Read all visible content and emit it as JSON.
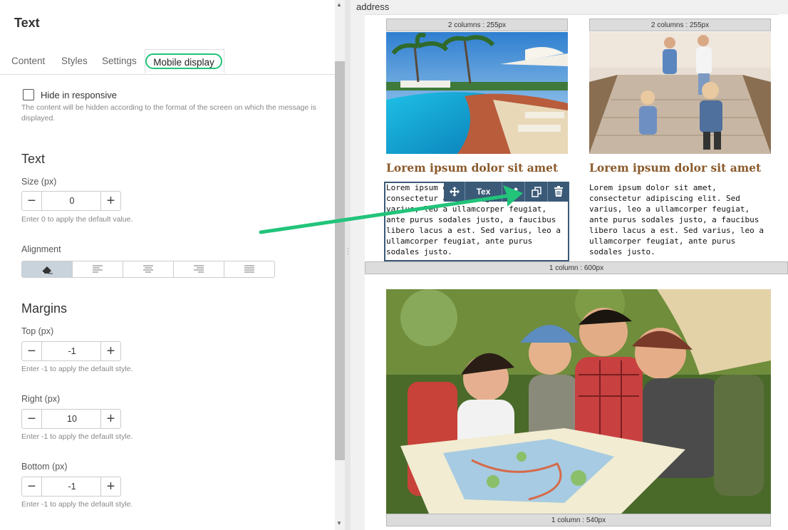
{
  "panel": {
    "title": "Text",
    "tabs": [
      {
        "label": "Content"
      },
      {
        "label": "Styles"
      },
      {
        "label": "Settings"
      },
      {
        "label": "Mobile display",
        "active": true
      }
    ],
    "hide_responsive": {
      "label": "Hide in responsive",
      "checked": false,
      "hint": "The content will be hidden according to the format of the screen on which the message is displayed."
    },
    "text_section": {
      "heading": "Text",
      "size_label": "Size (px)",
      "size_value": "0",
      "size_hint": "Enter 0 to apply the default value.",
      "alignment_label": "Alignment",
      "alignment_options": [
        "eraser-icon",
        "align-left-icon",
        "align-center-icon",
        "align-right-icon",
        "align-justify-icon"
      ],
      "alignment_selected": 0
    },
    "margins": {
      "heading": "Margins",
      "top_label": "Top (px)",
      "top_value": "-1",
      "top_hint": "Enter -1 to apply the default style.",
      "right_label": "Right (px)",
      "right_value": "10",
      "right_hint": "Enter -1 to apply the default style.",
      "bottom_label": "Bottom (px)",
      "bottom_value": "-1",
      "bottom_hint": "Enter -1 to apply the default style."
    }
  },
  "preview": {
    "address_label": "address",
    "columns": [
      {
        "label": "2 columns : 255px",
        "title": "Lorem ipsum dolor sit amet",
        "body": "Lorem ipsum dolor sit amet, consectetur adipiscing elit. Sed varius, leo a ullamcorper feugiat, ante purus sodales justo, a faucibus libero lacus a est. Sed varius, leo a ullamcorper feugiat, ante purus sodales justo."
      },
      {
        "label": "2 columns : 255px",
        "title": "Lorem ipsum dolor sit amet",
        "body": "Lorem ipsum dolor sit amet, consectetur adipiscing elit. Sed varius, leo a ullamcorper feugiat, ante purus sodales justo, a faucibus libero lacus a est. Sed varius, leo a ullamcorper feugiat, ante purus sodales justo."
      }
    ],
    "one_column_label": "1 column : 600px",
    "bottom_image_label": "1 column : 540px",
    "toolbar": {
      "text_button": "Tex",
      "icons": [
        "move-icon",
        "text-icon",
        "pencil-icon",
        "duplicate-icon",
        "trash-icon"
      ]
    }
  },
  "colors": {
    "accent_green": "#22c47a",
    "title_brown": "#8b5a2b",
    "toolbar_blue": "#3a5a78"
  }
}
